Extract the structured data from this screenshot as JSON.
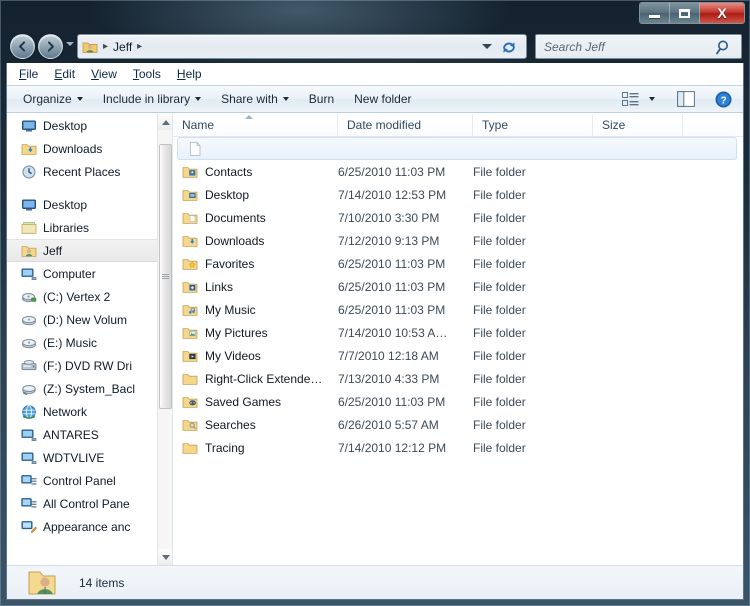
{
  "window": {
    "buttons": {
      "minimize": "Minimize",
      "maximize": "Maximize",
      "close": "Close",
      "close_glyph": "X"
    }
  },
  "address": {
    "back_tooltip": "Back",
    "forward_tooltip": "Forward",
    "crumb": "Jeff",
    "separator": "▸",
    "dropdown_tooltip": "Previous Locations",
    "refresh_tooltip": "Refresh"
  },
  "search": {
    "placeholder": "Search Jeff",
    "value": "",
    "icon": "search-icon"
  },
  "menubar": {
    "items": [
      {
        "accel": "F",
        "rest": "ile"
      },
      {
        "accel": "E",
        "rest": "dit"
      },
      {
        "accel": "V",
        "rest": "iew"
      },
      {
        "accel": "T",
        "rest": "ools"
      },
      {
        "accel": "H",
        "rest": "elp"
      }
    ]
  },
  "toolbar": {
    "organize": "Organize",
    "include_in_library": "Include in library",
    "share_with": "Share with",
    "burn": "Burn",
    "new_folder": "New folder",
    "view_icon": "view-layout-icon",
    "preview_icon": "preview-pane-icon",
    "help_icon": "help-icon"
  },
  "sidebar": {
    "items": [
      {
        "label": "Desktop",
        "icon": "desktop-icon",
        "indent": 1,
        "selected": false,
        "gap_before": false
      },
      {
        "label": "Downloads",
        "icon": "downloads-icon",
        "indent": 1,
        "selected": false,
        "gap_before": false
      },
      {
        "label": "Recent Places",
        "icon": "recent-places-icon",
        "indent": 1,
        "selected": false,
        "gap_before": false
      },
      {
        "label": "Desktop",
        "icon": "desktop-icon",
        "indent": 0,
        "selected": false,
        "gap_before": true
      },
      {
        "label": "Libraries",
        "icon": "libraries-icon",
        "indent": 0,
        "selected": false,
        "gap_before": false
      },
      {
        "label": "Jeff",
        "icon": "user-folder-icon",
        "indent": 0,
        "selected": true,
        "gap_before": false
      },
      {
        "label": "Computer",
        "icon": "computer-icon",
        "indent": 0,
        "selected": false,
        "gap_before": false
      },
      {
        "label": "(C:) Vertex 2",
        "icon": "hard-drive-icon",
        "indent": 1,
        "selected": false,
        "gap_before": false
      },
      {
        "label": "(D:) New Volum",
        "icon": "drive-icon",
        "indent": 1,
        "selected": false,
        "gap_before": false
      },
      {
        "label": "(E:) Music",
        "icon": "drive-icon",
        "indent": 1,
        "selected": false,
        "gap_before": false
      },
      {
        "label": "(F:) DVD RW Dri",
        "icon": "dvd-drive-icon",
        "indent": 1,
        "selected": false,
        "gap_before": false
      },
      {
        "label": "(Z:) System_Bacl",
        "icon": "network-drive-icon",
        "indent": 1,
        "selected": false,
        "gap_before": false
      },
      {
        "label": "Network",
        "icon": "network-icon",
        "indent": 0,
        "selected": false,
        "gap_before": false
      },
      {
        "label": "ANTARES",
        "icon": "computer-icon",
        "indent": 1,
        "selected": false,
        "gap_before": false
      },
      {
        "label": "WDTVLIVE",
        "icon": "computer-icon",
        "indent": 1,
        "selected": false,
        "gap_before": false
      },
      {
        "label": "Control Panel",
        "icon": "control-panel-icon",
        "indent": 0,
        "selected": false,
        "gap_before": false
      },
      {
        "label": "All Control Pane",
        "icon": "control-panel-icon",
        "indent": 1,
        "selected": false,
        "gap_before": false
      },
      {
        "label": "Appearance anc",
        "icon": "appearance-icon",
        "indent": 1,
        "selected": false,
        "gap_before": false
      }
    ]
  },
  "filelist": {
    "columns": [
      "Name",
      "Date modified",
      "Type",
      "Size"
    ],
    "sort_column": "Name",
    "sort_direction": "ascending",
    "rows": [
      {
        "name": "",
        "date": "",
        "type": "",
        "size": "",
        "icon": "blank-document-icon",
        "selected": true
      },
      {
        "name": "Contacts",
        "date": "6/25/2010 11:03 PM",
        "type": "File folder",
        "size": "",
        "icon": "contacts-folder-icon",
        "selected": false
      },
      {
        "name": "Desktop",
        "date": "7/14/2010 12:53 PM",
        "type": "File folder",
        "size": "",
        "icon": "desktop-folder-icon",
        "selected": false
      },
      {
        "name": "Documents",
        "date": "7/10/2010 3:30 PM",
        "type": "File folder",
        "size": "",
        "icon": "documents-folder-icon",
        "selected": false
      },
      {
        "name": "Downloads",
        "date": "7/12/2010 9:13 PM",
        "type": "File folder",
        "size": "",
        "icon": "downloads-folder-icon",
        "selected": false
      },
      {
        "name": "Favorites",
        "date": "6/25/2010 11:03 PM",
        "type": "File folder",
        "size": "",
        "icon": "favorites-folder-icon",
        "selected": false
      },
      {
        "name": "Links",
        "date": "6/25/2010 11:03 PM",
        "type": "File folder",
        "size": "",
        "icon": "links-folder-icon",
        "selected": false
      },
      {
        "name": "My Music",
        "date": "6/25/2010 11:03 PM",
        "type": "File folder",
        "size": "",
        "icon": "music-folder-icon",
        "selected": false
      },
      {
        "name": "My Pictures",
        "date": "7/14/2010 10:53 A…",
        "type": "File folder",
        "size": "",
        "icon": "pictures-folder-icon",
        "selected": false
      },
      {
        "name": "My Videos",
        "date": "7/7/2010 12:18 AM",
        "type": "File folder",
        "size": "",
        "icon": "videos-folder-icon",
        "selected": false
      },
      {
        "name": "Right-Click Extende…",
        "date": "7/13/2010 4:33 PM",
        "type": "File folder",
        "size": "",
        "icon": "folder-icon",
        "selected": false
      },
      {
        "name": "Saved Games",
        "date": "6/25/2010 11:03 PM",
        "type": "File folder",
        "size": "",
        "icon": "saved-games-folder-icon",
        "selected": false
      },
      {
        "name": "Searches",
        "date": "6/26/2010 5:57 AM",
        "type": "File folder",
        "size": "",
        "icon": "searches-folder-icon",
        "selected": false
      },
      {
        "name": "Tracing",
        "date": "7/14/2010 12:12 PM",
        "type": "File folder",
        "size": "",
        "icon": "folder-icon",
        "selected": false
      }
    ]
  },
  "status": {
    "item_count": "14 items",
    "icon": "user-folder-icon"
  },
  "colors": {
    "frame": "#2e4354",
    "close_button": "#c4362c",
    "selection": "#e8f1fa",
    "folder": "#f6d68a",
    "header_text": "#2e4a63"
  }
}
